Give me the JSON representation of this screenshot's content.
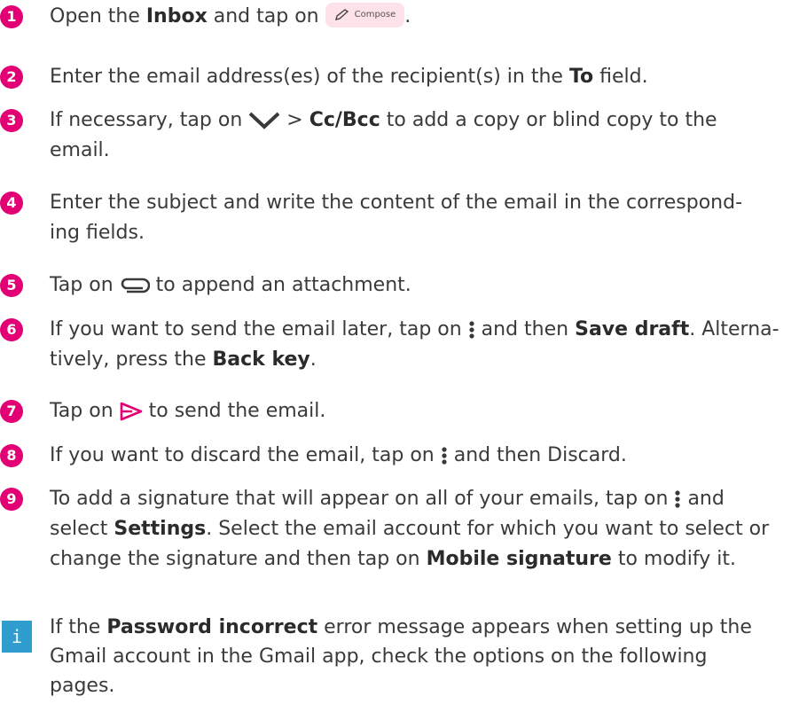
{
  "colors": {
    "accent": "#e20074",
    "info": "#2f9ecf",
    "compose_bg": "#fde2ea"
  },
  "steps": [
    {
      "num": "1",
      "t1": "Open the ",
      "b1": "Inbox",
      "t2": " and tap on ",
      "compose_label": "Compose",
      "t3": "."
    },
    {
      "num": "2",
      "t1": "Enter the email address(es) of the recipient(s) in the ",
      "b1": "To",
      "t2": " field."
    },
    {
      "num": "3",
      "t1": "If necessary, tap on ",
      "icon": "chevron-down-icon",
      "t2": " > ",
      "b1": "Cc/Bcc",
      "t3": " to add a copy or blind copy to the",
      "t4": "email."
    },
    {
      "num": "4",
      "t1": "Enter the subject and write the content of the email in the correspond-",
      "t2": "ing fields."
    },
    {
      "num": "5",
      "t1": "Tap on ",
      "icon": "paperclip-icon",
      "t2": " to append an attachment."
    },
    {
      "num": "6",
      "t1": "If you want to send the email later, tap on ",
      "icon": "more-vert-icon",
      "t2": " and then ",
      "b1": "Save draft",
      "t3": ". Alterna-",
      "t4": "tively, press the ",
      "b2": "Back key",
      "t5": "."
    },
    {
      "num": "7",
      "t1": "Tap on ",
      "icon": "send-icon",
      "t2": " to send the email."
    },
    {
      "num": "8",
      "t1": "If you want to discard the email, tap on ",
      "icon": "more-vert-icon",
      "t2": " and then Discard."
    },
    {
      "num": "9",
      "t1": "To add a signature that will appear on all of your emails, tap on ",
      "icon": "more-vert-icon",
      "t2": " and",
      "t3": "select ",
      "b1": "Settings",
      "t4": ". Select the email account for which you want to select or",
      "t5": "change the signature and then tap on ",
      "b2": "Mobile signature",
      "t6": " to modify it."
    }
  ],
  "info": {
    "icon_label": "i",
    "t1": "If the ",
    "b1": "Password incorrect",
    "t2": " error message appears when setting up the",
    "t3": "Gmail account in the Gmail app, check the options on the following",
    "t4": "pages."
  }
}
